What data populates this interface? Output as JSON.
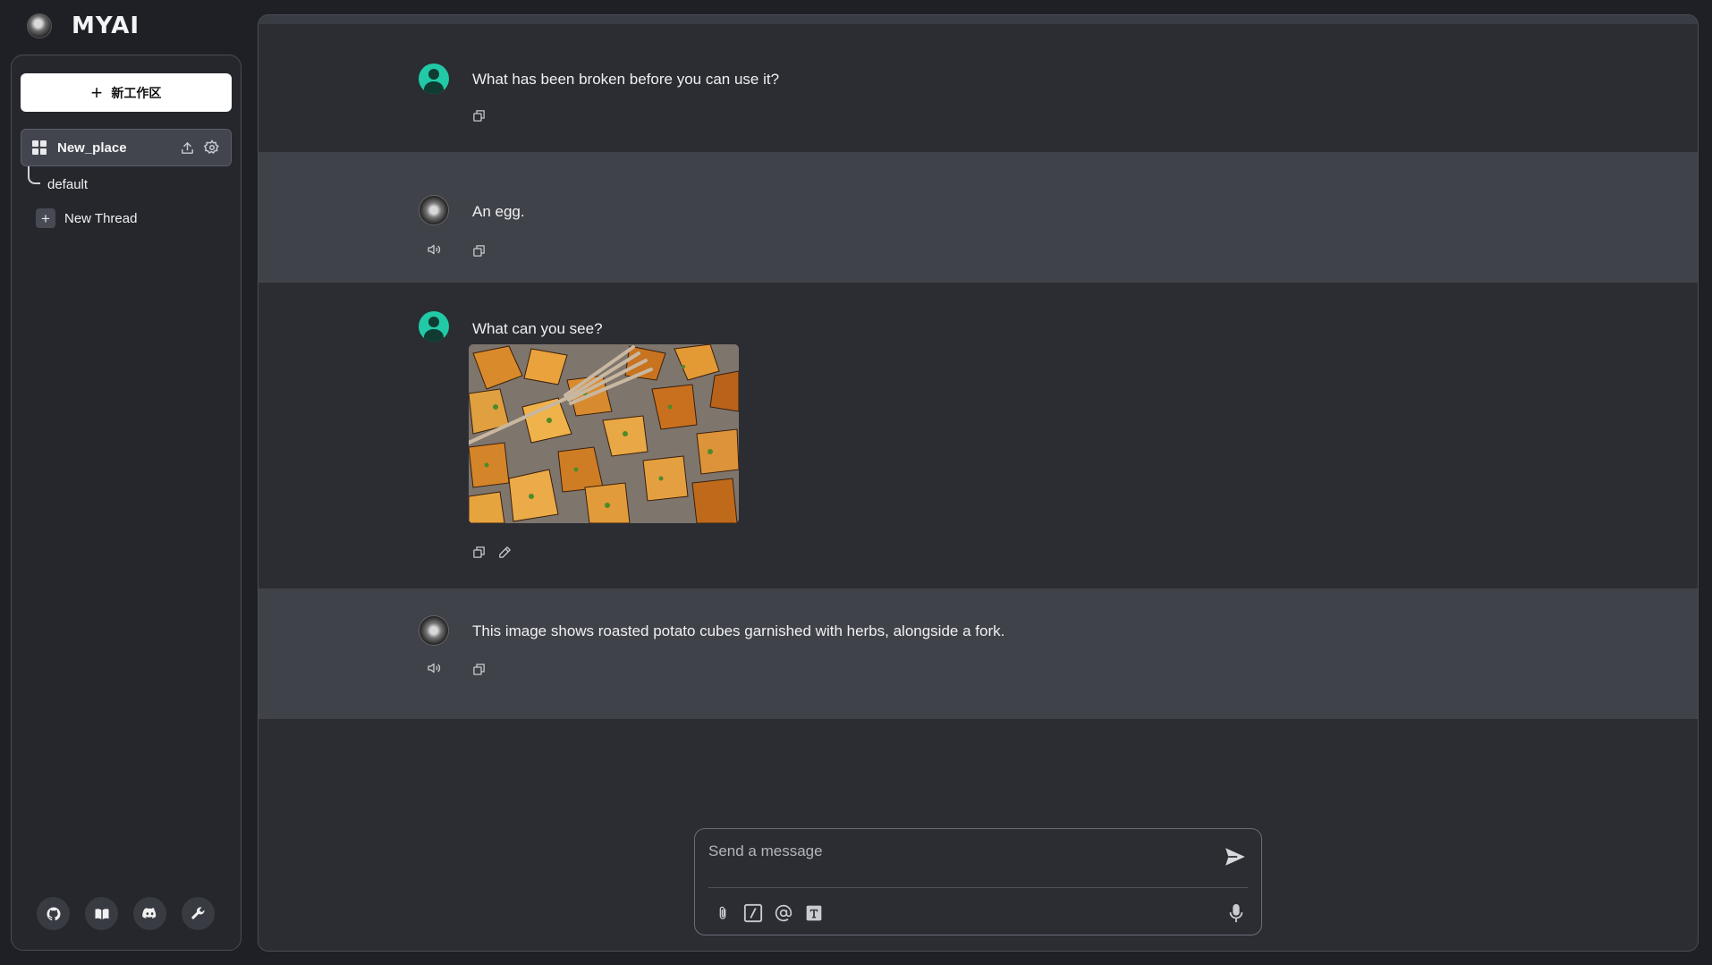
{
  "brand": {
    "wordmark": "MYAI"
  },
  "sidebar": {
    "new_workspace_label": "新工作区",
    "workspace": {
      "name": "New_place"
    },
    "threads": [
      {
        "label": "default"
      }
    ],
    "new_thread_label": "New Thread",
    "footer_icons": [
      "github-icon",
      "docs-book-icon",
      "discord-icon",
      "wrench-icon"
    ]
  },
  "chat": {
    "messages": [
      {
        "role": "user",
        "text": "What has been broken before you can use it?"
      },
      {
        "role": "assistant",
        "text": "An egg."
      },
      {
        "role": "user",
        "text": "What can you see?",
        "attachment": "roasted-potatoes-image"
      },
      {
        "role": "assistant",
        "text": "This image shows roasted potato cubes garnished with herbs, alongside a fork."
      }
    ]
  },
  "composer": {
    "placeholder": "Send a message",
    "tools": [
      "paperclip-icon",
      "slash-command-icon",
      "at-mention-icon",
      "text-format-icon"
    ]
  },
  "colors": {
    "background": "#1f2026",
    "panel": "#2b2d33",
    "assistant_row": "#404249",
    "user_avatar": "#22c9a6"
  }
}
